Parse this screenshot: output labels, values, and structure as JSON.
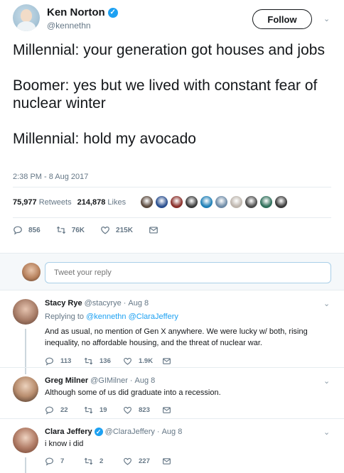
{
  "main_tweet": {
    "display_name": "Ken Norton",
    "handle": "@kennethn",
    "follow_label": "Follow",
    "text": "Millennial: your generation got houses and jobs\n\nBoomer: yes but we lived with constant fear of nuclear winter\n\nMillennial: hold my avocado",
    "timestamp": "2:38 PM - 8 Aug 2017",
    "retweets_count": "75,977",
    "retweets_label": "Retweets",
    "likes_count": "214,878",
    "likes_label": "Likes",
    "liker_colors": [
      "#5b4a3e",
      "#2a4f8f",
      "#8a2f2a",
      "#3b3b3b",
      "#1f7fb6",
      "#6d8aa6",
      "#bdb5ad",
      "#4c4c4c",
      "#2f6f5a",
      "#3a3a3a"
    ],
    "actions": {
      "replies": "856",
      "retweets": "76K",
      "likes": "215K"
    }
  },
  "reply_box": {
    "placeholder": "Tweet your reply"
  },
  "replies": [
    {
      "name": "Stacy Rye",
      "handle": "@stacyrye",
      "date": "Aug 8",
      "replying_prefix": "Replying to",
      "replying_handles": "@kennethn @ClaraJeffery",
      "text": "And as usual, no mention of Gen X anywhere. We were lucky w/ both, rising inequality, no affordable housing, and the threat of nuclear war.",
      "replies": "113",
      "retweets": "136",
      "likes": "1.9K"
    },
    {
      "name": "Greg Milner",
      "handle": "@GIMilner",
      "date": "Aug 8",
      "text": "Although some of us did graduate into a recession.",
      "replies": "22",
      "retweets": "19",
      "likes": "823"
    },
    {
      "name": "Clara Jeffery",
      "handle": "@ClaraJeffery",
      "date": "Aug 8",
      "text": "i know i did",
      "replies": "7",
      "retweets": "2",
      "likes": "227"
    }
  ],
  "colors": {
    "accent": "#1da1f2",
    "muted": "#657786",
    "text": "#14171a"
  }
}
